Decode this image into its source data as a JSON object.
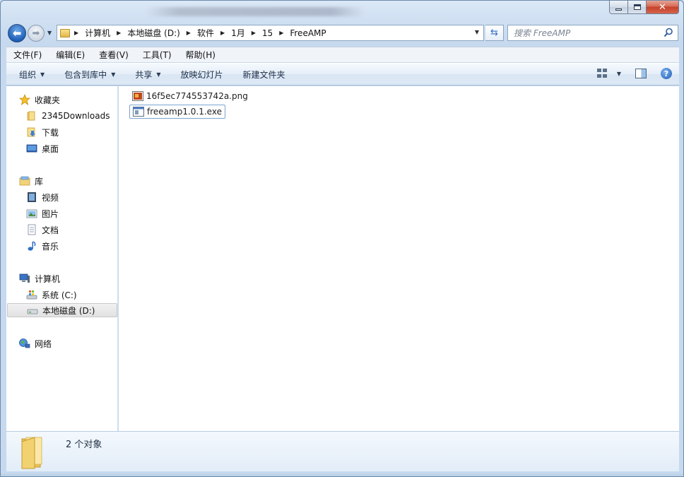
{
  "window": {
    "close_glyph": "✕"
  },
  "nav": {
    "back_glyph": "⬅",
    "forward_glyph": "➡"
  },
  "address": {
    "crumbs": [
      "计算机",
      "本地磁盘 (D:)",
      "软件",
      "1月",
      "15",
      "FreeAMP"
    ]
  },
  "search": {
    "placeholder": "搜索 FreeAMP"
  },
  "menu": {
    "items": [
      "文件(F)",
      "编辑(E)",
      "查看(V)",
      "工具(T)",
      "帮助(H)"
    ]
  },
  "toolbar": {
    "organize": "组织",
    "include_library": "包含到库中",
    "share": "共享",
    "slideshow": "放映幻灯片",
    "new_folder": "新建文件夹"
  },
  "sidebar": {
    "favorites": {
      "label": "收藏夹",
      "items": [
        "2345Downloads",
        "下载",
        "桌面"
      ]
    },
    "libraries": {
      "label": "库",
      "items": [
        "视频",
        "图片",
        "文档",
        "音乐"
      ]
    },
    "computer": {
      "label": "计算机",
      "items": [
        "系统 (C:)",
        "本地磁盘 (D:)"
      ]
    },
    "network": {
      "label": "网络"
    }
  },
  "files": [
    {
      "name": "16f5ec774553742a.png",
      "icon": "png-image-icon"
    },
    {
      "name": "freeamp1.0.1.exe",
      "icon": "exe-app-icon"
    }
  ],
  "status": {
    "count_text": "2 个对象"
  },
  "colors": {
    "accent": "#1f5fb8",
    "window_frame": "#c6d9ee",
    "close_red": "#c5412a"
  }
}
